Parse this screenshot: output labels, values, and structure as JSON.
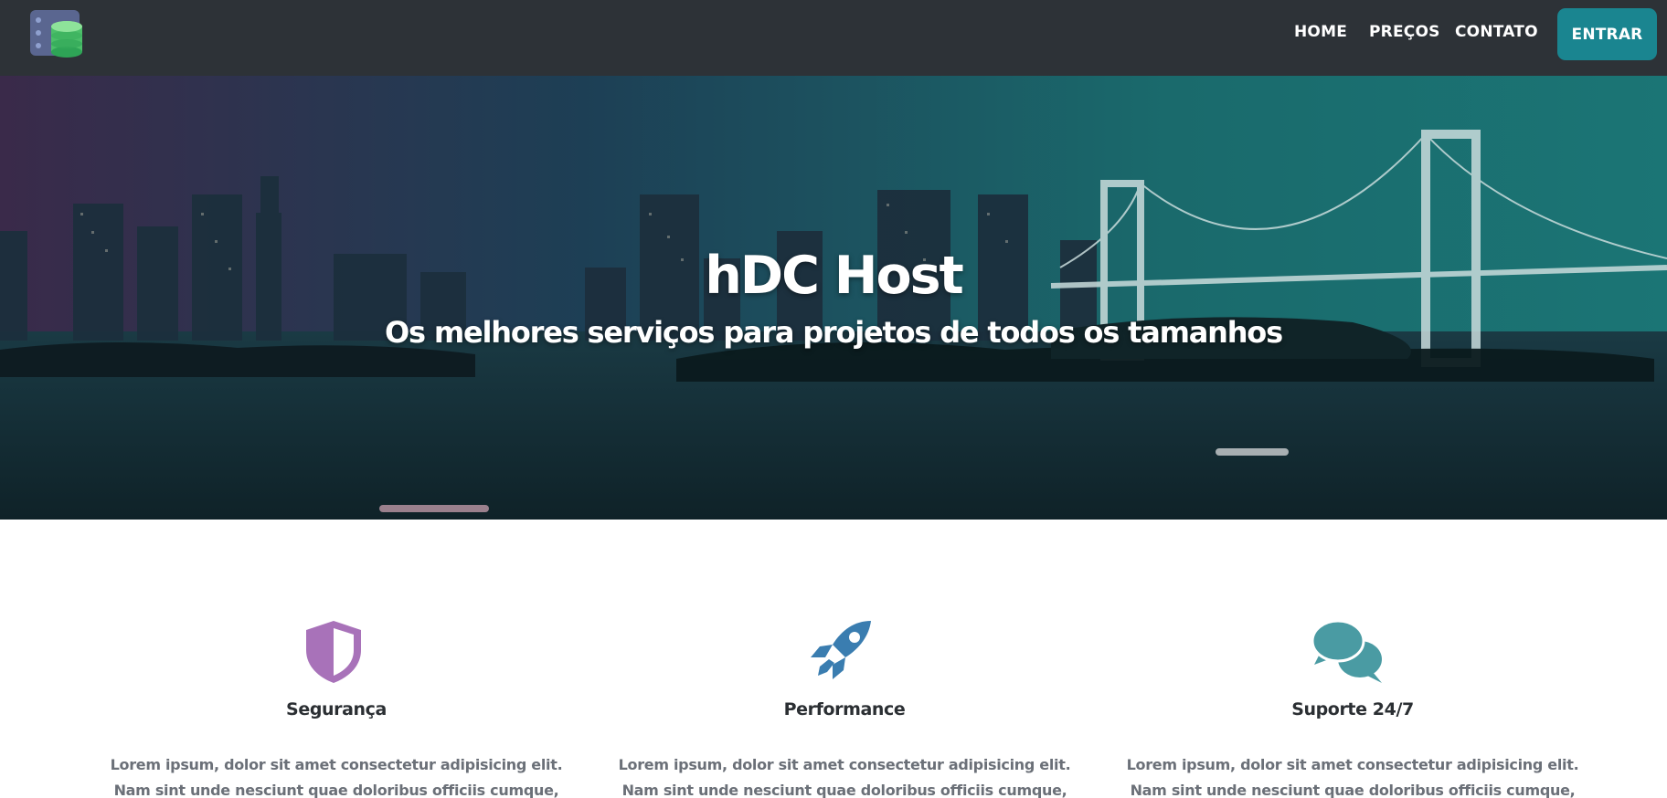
{
  "nav": {
    "logo_icon": "database-server-icon",
    "links": [
      {
        "label": "HOME"
      },
      {
        "label": "PREÇOS"
      },
      {
        "label": "CONTATO"
      }
    ],
    "cta_label": "ENTRAR",
    "background": "#2d3237",
    "accent": "#1a8590"
  },
  "hero": {
    "title": "hDC Host",
    "subtitle": "Os melhores serviços para projetos de todos os tamanhos",
    "background_image": "night city skyline with suspension bridge over water"
  },
  "features": [
    {
      "icon": "shield-icon",
      "color": "#a872b9",
      "title": "Segurança",
      "text": "Lorem ipsum, dolor sit amet consectetur adipisicing elit. Nam sint unde nesciunt quae doloribus officiis cumque, alias"
    },
    {
      "icon": "rocket-icon",
      "color": "#3a7db0",
      "title": "Performance",
      "text": "Lorem ipsum, dolor sit amet consectetur adipisicing elit. Nam sint unde nesciunt quae doloribus officiis cumque, alias"
    },
    {
      "icon": "chat-bubbles-icon",
      "color": "#4a9ba3",
      "title": "Suporte 24/7",
      "text": "Lorem ipsum, dolor sit amet consectetur adipisicing elit. Nam sint unde nesciunt quae doloribus officiis cumque, alias"
    }
  ]
}
